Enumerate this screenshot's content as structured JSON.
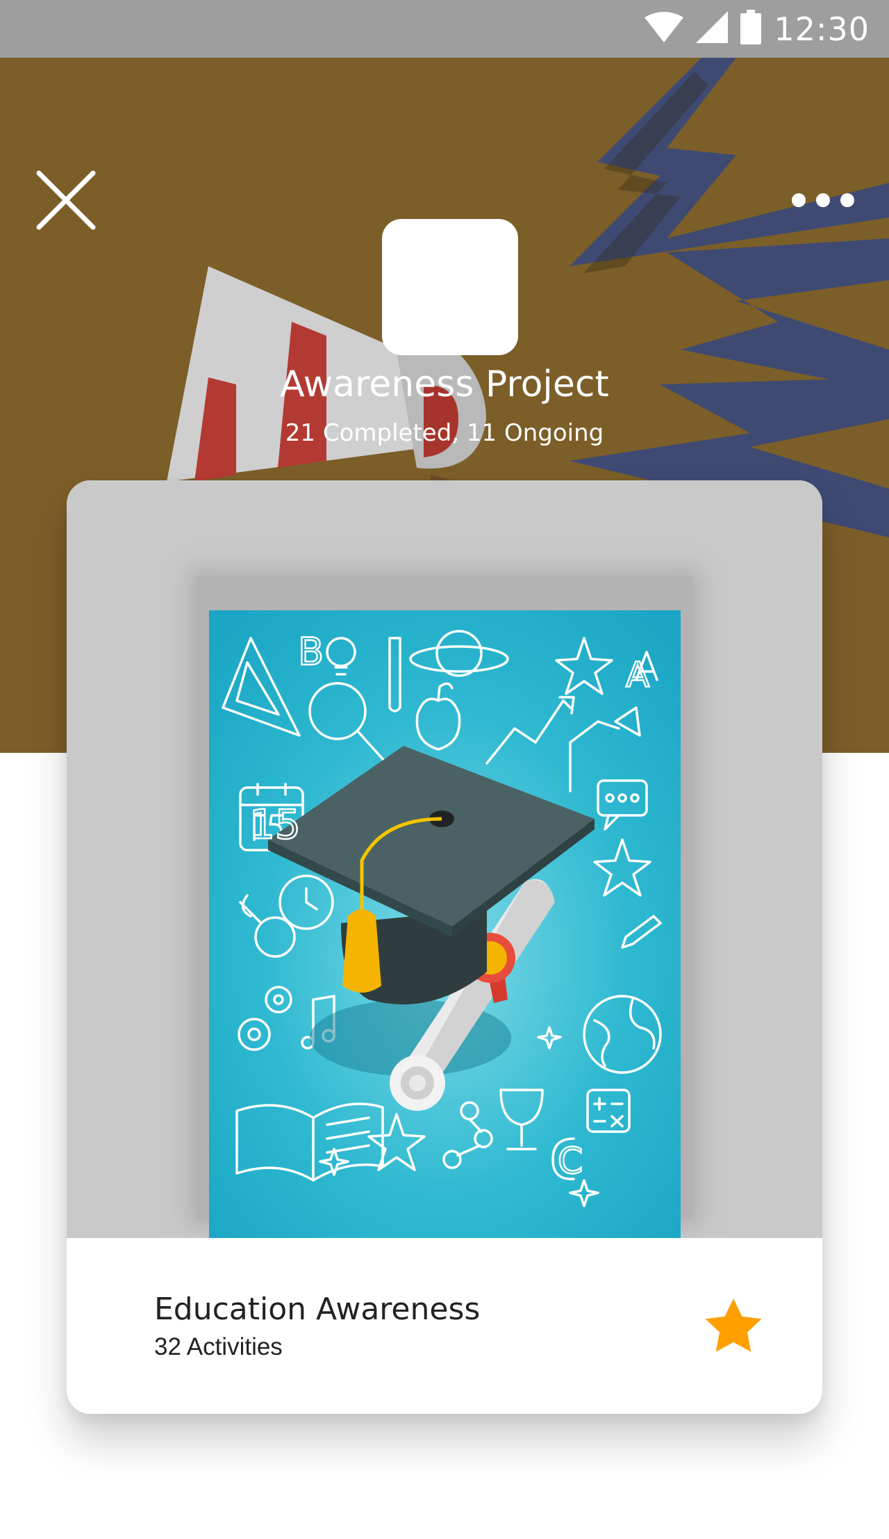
{
  "status_bar": {
    "time": "12:30"
  },
  "header": {
    "title": "Awareness Project",
    "subtitle": "21 Completed, 11 Ongoing",
    "background_color": "#7c5e28"
  },
  "card": {
    "title": "Education Awareness",
    "activities": "32 Activities",
    "favorite": true,
    "star_color": "#ff9f00",
    "poster_color": "#1cabc8"
  },
  "poster": {
    "letters": [
      "B",
      "A",
      "C"
    ],
    "calendar_day": "15"
  }
}
